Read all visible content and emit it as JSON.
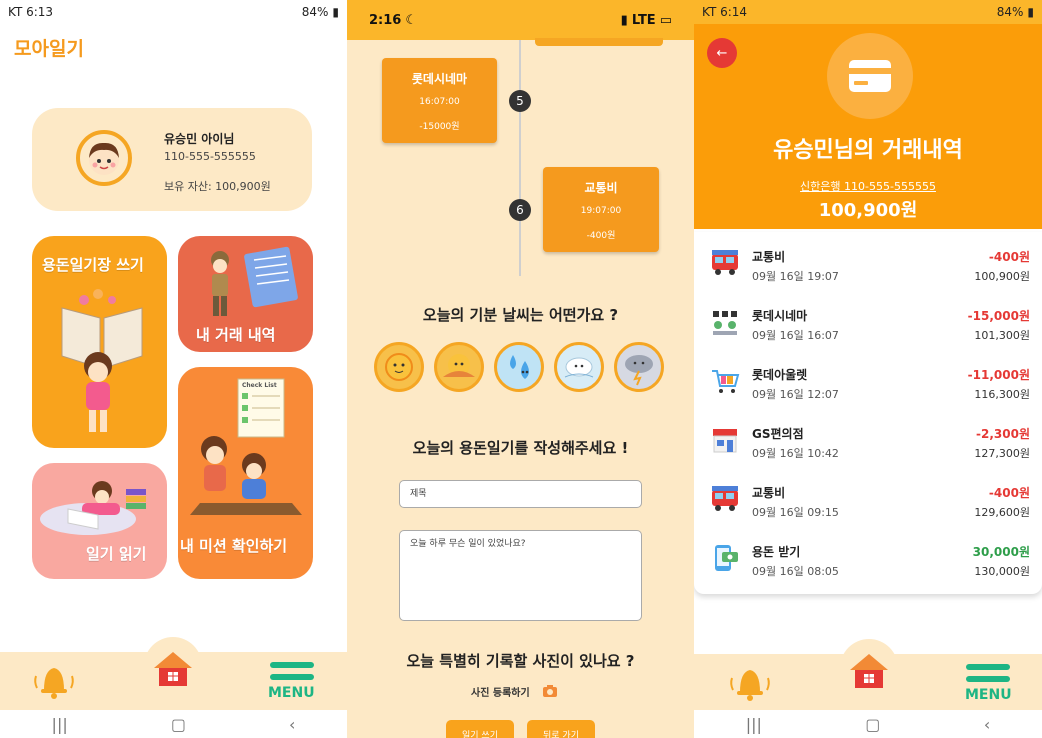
{
  "panel1": {
    "status": {
      "carrier": "KT 6:13",
      "battery": "84%"
    },
    "logo": "모아일기",
    "profile": {
      "name": "유승민 아이님",
      "account": "110-555-555555",
      "assets": "보유 자산: 100,900원"
    },
    "cards": {
      "diary_write": "용돈일기장 쓰기",
      "transactions": "내 거래 내역",
      "diary_read": "일기 읽기",
      "missions": "내 미션 확인하기",
      "checklist_label": "Check List"
    },
    "nav": {
      "menu_label": "MENU"
    }
  },
  "panel2": {
    "status": {
      "time": "2:16",
      "network": "LTE"
    },
    "timeline": [
      {
        "num": "5",
        "title": "롯데시네마",
        "time": "16:07:00",
        "amount": "-15000원"
      },
      {
        "num": "6",
        "title": "교통비",
        "time": "19:07:00",
        "amount": "-400원"
      }
    ],
    "weather_question": "오늘의 기분 날씨는 어떤가요 ?",
    "diary_prompt": "오늘의 용돈일기를 작성해주세요 !",
    "title_placeholder": "제목",
    "body_placeholder": "오늘 하루 무슨 일이 있었나요?",
    "photo_question": "오늘 특별히 기록할 사진이 있나요 ?",
    "photo_register": "사진 등록하기",
    "buttons": {
      "write": "일기 쓰기",
      "back": "뒤로 가기"
    }
  },
  "panel3": {
    "status": {
      "carrier": "KT 6:14",
      "battery": "84%"
    },
    "title": "유승민님의 거래내역",
    "account": "신한은행 110-555-555555",
    "balance": "100,900원",
    "transactions": [
      {
        "name": "교통비",
        "date": "09월 16일 19:07",
        "amount": "-400원",
        "balance": "100,900원",
        "kind": "bus"
      },
      {
        "name": "롯데시네마",
        "date": "09월 16일 16:07",
        "amount": "-15,000원",
        "balance": "101,300원",
        "kind": "cinema"
      },
      {
        "name": "롯데아울렛",
        "date": "09월 16일 12:07",
        "amount": "-11,000원",
        "balance": "116,300원",
        "kind": "cart"
      },
      {
        "name": "GS편의점",
        "date": "09월 16일 10:42",
        "amount": "-2,300원",
        "balance": "127,300원",
        "kind": "store"
      },
      {
        "name": "교통비",
        "date": "09월 16일 09:15",
        "amount": "-400원",
        "balance": "129,600원",
        "kind": "bus"
      },
      {
        "name": "용돈 받기",
        "date": "09월 16일 08:05",
        "amount": "30,000원",
        "balance": "130,000원",
        "kind": "money"
      }
    ],
    "nav": {
      "menu_label": "MENU"
    }
  },
  "colors": {
    "orange": "#fb9d09",
    "cream": "#fde9c6",
    "green": "#1db584",
    "debit": "#e53935",
    "credit": "#2e9e4a"
  }
}
